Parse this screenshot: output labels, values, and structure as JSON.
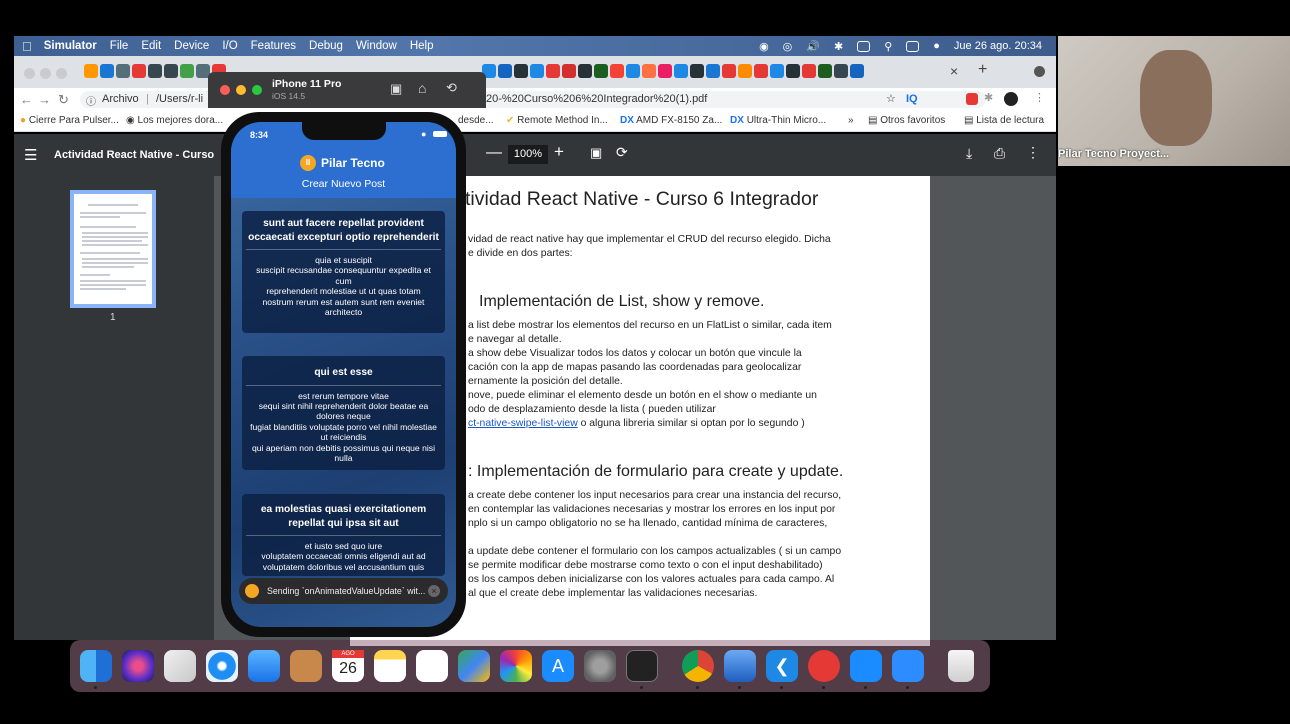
{
  "menubar": {
    "app": "Simulator",
    "items": [
      "File",
      "Edit",
      "Device",
      "I/O",
      "Features",
      "Debug",
      "Window",
      "Help"
    ],
    "datetime": "Jue 26 ago.  20:34"
  },
  "chrome": {
    "archivo": "Archivo",
    "path": "/Users/r-li",
    "url_tail": "20-%20Curso%206%20Integrador%20(1).pdf",
    "tab_close": "×",
    "tab_new": "+",
    "bookmarks": {
      "b1": "Cierre Para Pulser...",
      "b2": "Los mejores dora...",
      "b3": "desde...",
      "b4": "Remote Method In...",
      "b5": "AMD FX-8150 Za...",
      "b6": "Ultra-Thin Micro...",
      "more": "»",
      "otros": "Otros favoritos",
      "lectura": "Lista de lectura"
    }
  },
  "pdf": {
    "title": "Actividad React Native - Curso 6 Int",
    "zoom": "100%",
    "page_number": "1",
    "heading": "tividad React Native - Curso 6 Integrador",
    "intro": [
      "vidad de react native hay que implementar el CRUD del recurso elegido. Dicha",
      "e divide en dos partes:"
    ],
    "section1": "Implementación de List, show y remove.",
    "s1_lines": [
      "a list debe mostrar los elementos del recurso en un FlatList o similar, cada item",
      "e navegar al detalle.",
      "a show debe Visualizar todos los datos y colocar un botón que vincule la",
      "cación con la app de mapas pasando las coordenadas para geolocalizar",
      "ernamente la posición del detalle.",
      "nove, puede eliminar el elemento desde un botón en el show o mediante un",
      "odo de desplazamiento desde la lista ( pueden utilizar"
    ],
    "s1_link": "ct-native-swipe-list-view",
    "s1_link_tail": " o alguna libreria similar si optan por lo segundo )",
    "section2": ": Implementación de formulario para create y update.",
    "s2_lines": [
      "a create debe contener los input necesarios para crear una instancia del recurso,",
      "en contemplar las validaciones necesarias y mostrar los errores en los input por",
      "nplo si un campo obligatorio no se ha llenado, cantidad mínima de caracteres,",
      "",
      "a update debe contener el formulario con los campos actualizables ( si un campo",
      "se permite modificar debe mostrarse como texto o con el input deshabilitado)",
      "os los campos deben inicializarse con los valores actuales para cada campo. Al",
      "al que el create debe implementar las validaciones necesarias."
    ]
  },
  "simulator": {
    "device": "iPhone 11 Pro",
    "os": "iOS 14.5"
  },
  "phone": {
    "time": "8:34",
    "brand": "Pilar Tecno",
    "create_label": "Crear Nuevo Post",
    "posts": [
      {
        "title": "sunt aut facere repellat provident occaecati excepturi optio reprehenderit",
        "body": "quia et suscipit\nsuscipit recusandae consequuntur expedita et cum\nreprehenderit molestiae ut ut quas totam\nnostrum rerum est autem sunt rem eveniet architecto"
      },
      {
        "title": "qui est esse",
        "body": "est rerum tempore vitae\nsequi sint nihil reprehenderit dolor beatae ea dolores neque\nfugiat blanditiis voluptate porro vel nihil molestiae ut reiciendis\nqui aperiam non debitis possimus qui neque nisi nulla"
      },
      {
        "title": "ea molestias quasi exercitationem repellat qui ipsa sit aut",
        "body": "et iusto sed quo iure\nvoluptatem occaecati omnis eligendi aut ad\nvoluptatem doloribus vel accusantium quis"
      }
    ],
    "toast": "Sending `onAnimatedValueUpdate` wit..."
  },
  "dock": {
    "calendar_month": "AGO",
    "calendar_day": "26"
  },
  "webcam": {
    "participant": "Pilar Tecno Proyect..."
  }
}
